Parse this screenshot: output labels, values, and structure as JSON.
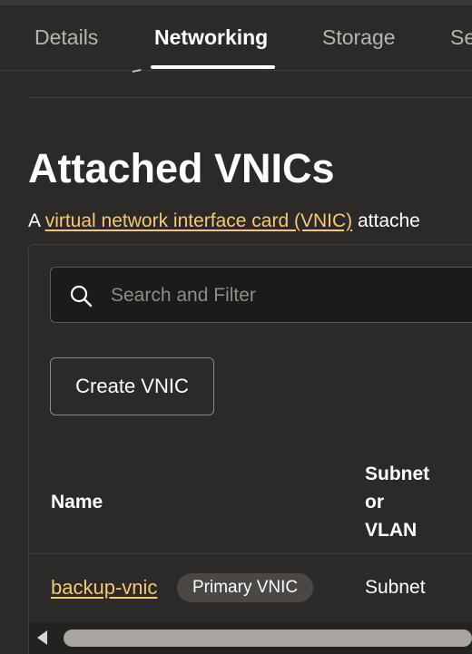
{
  "tabs": [
    {
      "label": "Details",
      "active": false
    },
    {
      "label": "Networking",
      "active": true
    },
    {
      "label": "Storage",
      "active": false
    },
    {
      "label": "Se",
      "active": false
    }
  ],
  "section": {
    "title": "Attached VNICs",
    "intro_prefix": "A ",
    "intro_link": "virtual network interface card (VNIC)",
    "intro_suffix": " attache"
  },
  "search": {
    "placeholder": "Search and Filter",
    "value": ""
  },
  "actions": {
    "create_label": "Create VNIC"
  },
  "table": {
    "headers": {
      "name": "Name",
      "subnet_line1": "Subnet",
      "subnet_line2": "or",
      "subnet_line3": "VLAN"
    },
    "rows": [
      {
        "name": "backup-vnic",
        "badge": "Primary VNIC",
        "subnet": "Subnet"
      }
    ]
  },
  "colors": {
    "accent_link": "#f5c872",
    "background": "#2b2a28",
    "badge_bg": "#4a4744"
  },
  "icons": {
    "search": "search-icon",
    "scroll_left": "arrow-left-icon"
  }
}
